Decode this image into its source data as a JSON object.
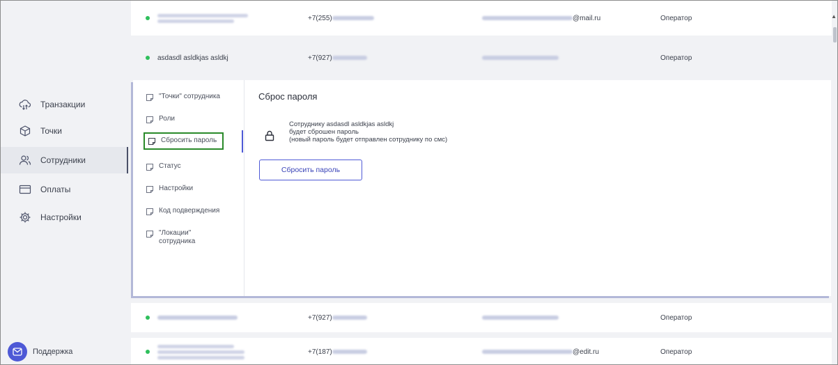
{
  "sidebar": {
    "items": [
      {
        "label": "Транзакции",
        "icon": "cloud-transfer-icon"
      },
      {
        "label": "Точки",
        "icon": "cube-icon"
      },
      {
        "label": "Сотрудники",
        "icon": "users-icon",
        "active": true
      },
      {
        "label": "Оплаты",
        "icon": "card-icon"
      },
      {
        "label": "Настройки",
        "icon": "gear-icon"
      }
    ],
    "support_label": "Поддержка"
  },
  "rows": [
    {
      "name": "",
      "phone": "+7(255)",
      "email_suffix": "@mail.ru",
      "role": "Оператор",
      "status": "online"
    },
    {
      "name": "asdasdl asldkjas asldkj",
      "phone": "+7(927)",
      "email_suffix": "",
      "role": "Оператор",
      "status": "online"
    },
    {
      "name": "",
      "phone": "+7(927)",
      "email_suffix": "",
      "role": "Оператор",
      "status": "online"
    },
    {
      "name": "",
      "phone": "+7(187)",
      "email_suffix": "@edit.ru",
      "role": "Оператор",
      "status": "online"
    }
  ],
  "panel": {
    "menu": [
      {
        "label": "\"Точки\" сотрудника"
      },
      {
        "label": "Роли"
      },
      {
        "label": "Сбросить пароль",
        "active": true
      },
      {
        "label": "Статус"
      },
      {
        "label": "Настройки"
      },
      {
        "label": "Код подверждения"
      },
      {
        "label": "\"Локации\" сотрудника"
      }
    ],
    "title": "Сброс пароля",
    "message_line1": "Сотруднику asdasdl asldkjas asldkj",
    "message_line2": "будет сброшен пароль",
    "message_line3": "(новый пароль будет отправлен сотруднику по смс)",
    "button_label": "Сбросить пароль"
  },
  "colors": {
    "accent": "#4e59d6",
    "online_dot": "#2fbf5c",
    "highlight_border": "#2a8a2a"
  }
}
